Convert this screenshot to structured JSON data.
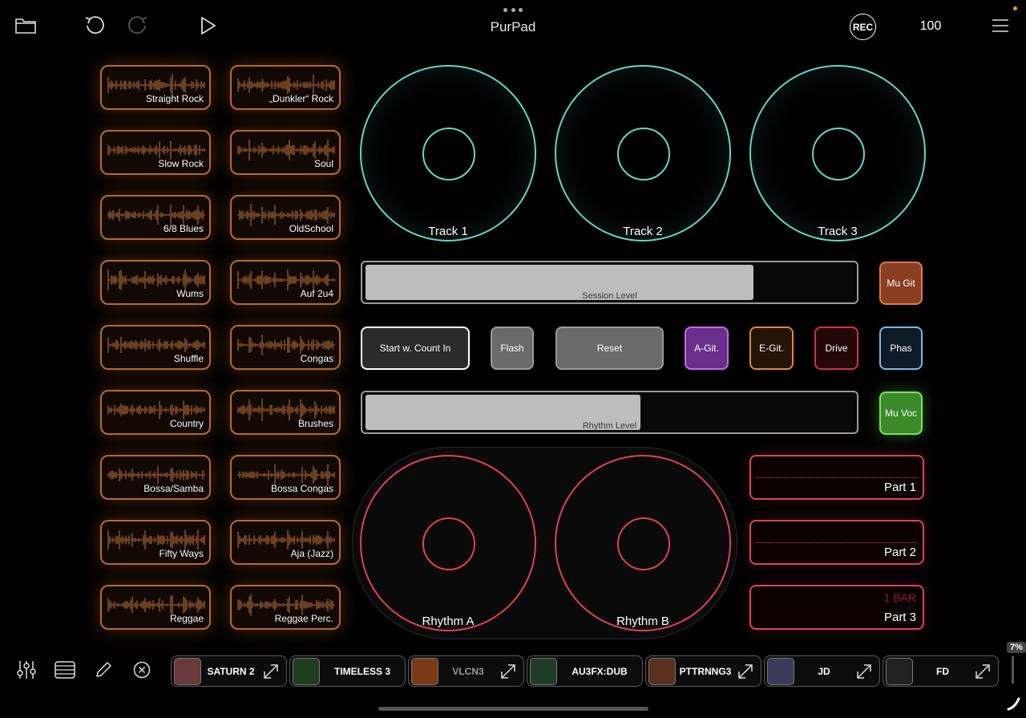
{
  "app": {
    "title": "PurPad",
    "record_label": "REC",
    "tempo": "100"
  },
  "colors": {
    "pad_border": "#b86a2c",
    "track": "#5fd8c8",
    "rhythm": "#e0405a"
  },
  "rhythm_pads": [
    {
      "label": "Straight Rock"
    },
    {
      "label": "„Dunkler“ Rock"
    },
    {
      "label": "Slow Rock"
    },
    {
      "label": "Soul"
    },
    {
      "label": "6/8 Blues"
    },
    {
      "label": "OldSchool"
    },
    {
      "label": "Wums"
    },
    {
      "label": "Auf 2u4"
    },
    {
      "label": "Shuffle"
    },
    {
      "label": "Congas"
    },
    {
      "label": "Country"
    },
    {
      "label": "Brushes"
    },
    {
      "label": "Bossa/Samba"
    },
    {
      "label": "Bossa Congas"
    },
    {
      "label": "Fifty Ways"
    },
    {
      "label": "Aja (Jazz)"
    },
    {
      "label": "Reggae"
    },
    {
      "label": "Reggae Perc."
    }
  ],
  "tracks": [
    {
      "label": "Track 1"
    },
    {
      "label": "Track 2"
    },
    {
      "label": "Track 3"
    }
  ],
  "session_level": {
    "label": "Session Level",
    "value": 0.79
  },
  "rhythm_level": {
    "label": "Rhythm Level",
    "value": 0.56
  },
  "buttons": {
    "start": "Start w. Count In",
    "flash": "Flash",
    "reset": "Reset",
    "a_git": "A-Git.",
    "e_git": "E-Git.",
    "drive": "Drive",
    "phas": "Phas",
    "mu_git": "Mu Git",
    "mu_voc": "Mu Voc"
  },
  "rhythms": [
    {
      "label": "Rhythm A"
    },
    {
      "label": "Rhythm B"
    }
  ],
  "parts": [
    {
      "label": "Part 1"
    },
    {
      "label": "Part 2"
    },
    {
      "label": "Part 3",
      "badge": "1 BAR"
    }
  ],
  "plugins": [
    {
      "name": "SATURN 2",
      "thumb": "#6a3a3a"
    },
    {
      "name": "TIMELESS 3",
      "thumb": "#1f3d1f"
    },
    {
      "name": "VLCN3",
      "thumb": "#7a3a16"
    },
    {
      "name": "AU3FX:DUB",
      "thumb": "#1f3d2a"
    },
    {
      "name": "PTTRNNG3",
      "thumb": "#5a3020"
    },
    {
      "name": "JD",
      "thumb": "#3a3a5a"
    },
    {
      "name": "FD",
      "thumb": "#222"
    }
  ],
  "cpu": "7%"
}
